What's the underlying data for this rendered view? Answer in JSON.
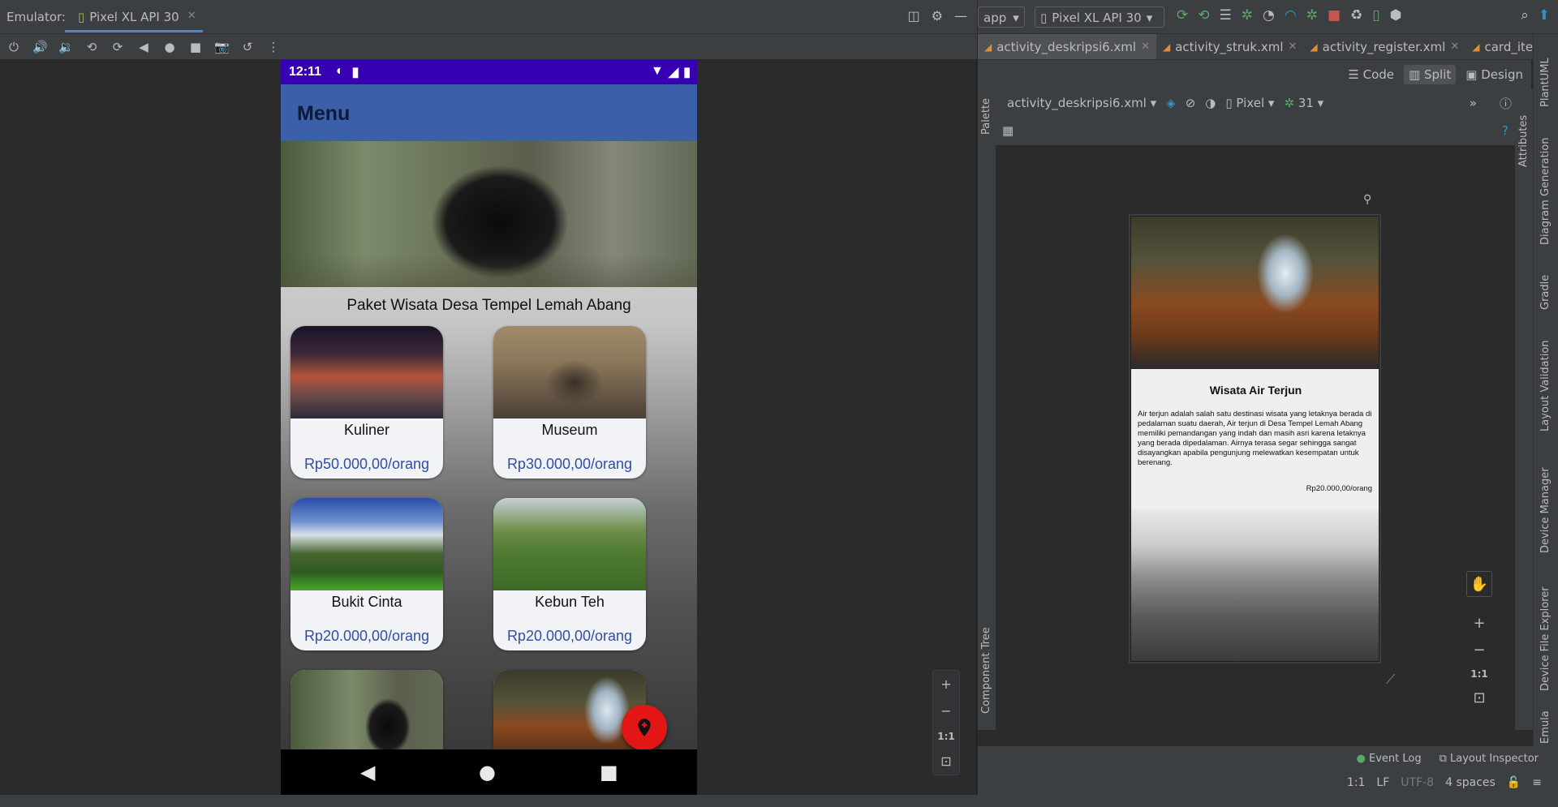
{
  "emulator": {
    "label": "Emulator:",
    "tab_name": "Pixel XL API 30",
    "toolbar_icons": [
      "power-icon",
      "volume-up-icon",
      "volume-down-icon",
      "rotate-left-icon",
      "rotate-right-icon",
      "back-icon",
      "home-icon",
      "overview-icon",
      "camera-icon",
      "snapshot-icon",
      "more-icon"
    ],
    "zoom": {
      "zoom_in": "+",
      "zoom_out": "−",
      "one_to_one": "1:1",
      "fit": "⊡"
    }
  },
  "phone": {
    "status_bar": {
      "time": "12:11"
    },
    "app_bar_title": "Menu",
    "package_title": "Paket Wisata Desa Tempel Lemah Abang",
    "cards": [
      {
        "name": "Kuliner",
        "price": "Rp50.000,00/orang",
        "image": "kuliner"
      },
      {
        "name": "Museum",
        "price": "Rp30.000,00/orang",
        "image": "museum"
      },
      {
        "name": "Bukit Cinta",
        "price": "Rp20.000,00/orang",
        "image": "bukit"
      },
      {
        "name": "Kebun Teh",
        "price": "Rp20.000,00/orang",
        "image": "kebun"
      },
      {
        "name": "",
        "price": "",
        "image": "gua"
      },
      {
        "name": "",
        "price": "",
        "image": "air"
      }
    ],
    "fab_icon": "add-location-icon",
    "colors": {
      "status_bar": "#3700b3",
      "app_bar": "#3b5fa8",
      "fab": "#e31616",
      "price": "#2f4fa3"
    }
  },
  "ide": {
    "run_config": "app",
    "device": "Pixel XL API 30",
    "file_tabs": [
      {
        "label": "activity_deskripsi6.xml",
        "active": true
      },
      {
        "label": "activity_struk.xml",
        "active": false
      },
      {
        "label": "activity_register.xml",
        "active": false
      },
      {
        "label": "card_iten",
        "active": false
      }
    ],
    "view_modes": {
      "code": "Code",
      "split": "Split",
      "design": "Design"
    },
    "design_toolbar": {
      "file": "activity_deskripsi6.xml",
      "device": "Pixel",
      "api": "31"
    },
    "left_strip": {
      "palette": "Palette",
      "component_tree": "Component Tree"
    },
    "right_strip": {
      "attributes": "Attributes"
    },
    "far_right": [
      "PlantUML",
      "Diagram Generation",
      "Gradle",
      "Layout Validation",
      "Device Manager",
      "Device File Explorer",
      "Emula"
    ],
    "preview": {
      "title": "Wisata Air Terjun",
      "description": "Air terjun adalah salah satu destinasi wisata yang letaknya berada di pedalaman suatu daerah, Air terjun di Desa Tempel Lemah Abang memiliki pemandangan yang indah dan masih asri karena letaknya yang berada dipedalaman. Airnya terasa segar sehingga sangat disayangkan apabila pengunjung melewatkan kesempatan untuk berenang.",
      "price": "Rp20.000,00/orang"
    },
    "design_zoom": {
      "zoom_in": "+",
      "zoom_out": "−",
      "one_to_one": "1:1",
      "fit": "⊡"
    },
    "bottom_bar": {
      "event_log": "Event Log",
      "layout_inspector": "Layout Inspector"
    },
    "status_line": {
      "position": "1:1",
      "line_sep": "LF",
      "encoding": "UTF-8",
      "indent": "4 spaces"
    }
  }
}
